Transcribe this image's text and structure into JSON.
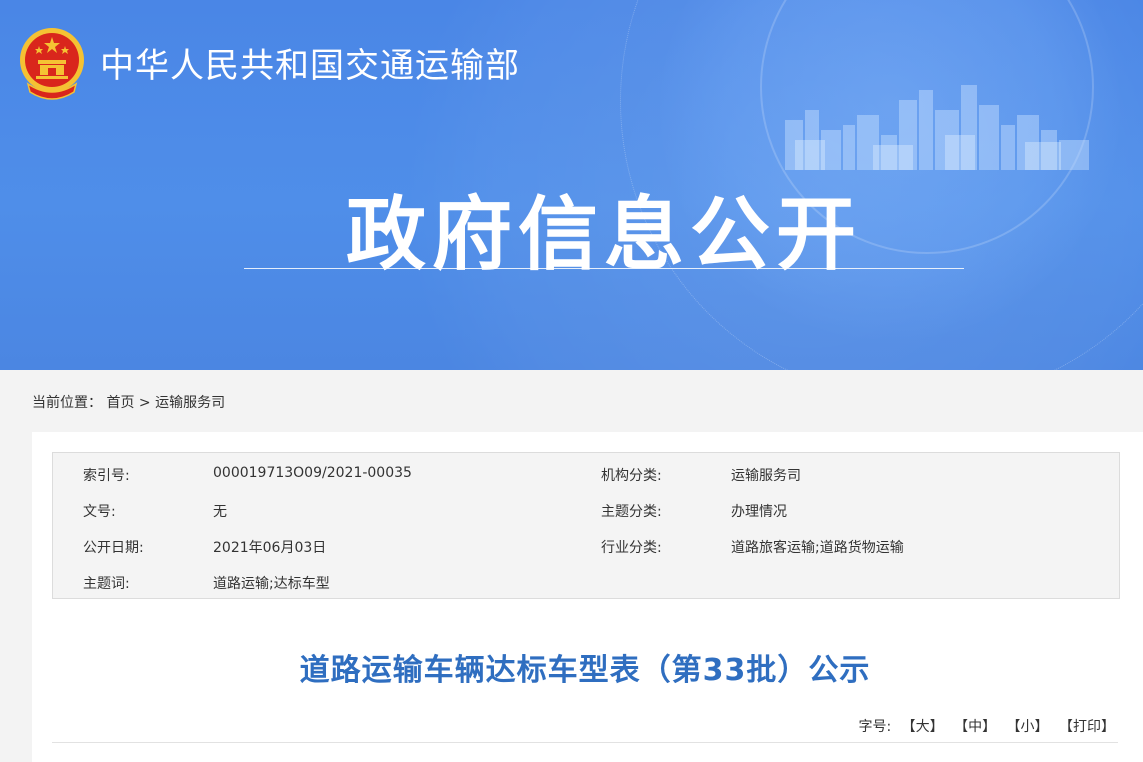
{
  "header": {
    "ministry_title": "中华人民共和国交通运输部",
    "banner_heading": "政府信息公开"
  },
  "breadcrumb": {
    "label": "当前位置：",
    "home": "首页",
    "separator": ">",
    "current": "运输服务司"
  },
  "meta": {
    "index_label": "索引号:",
    "index_value": "000019713O09/2021-00035",
    "org_label": "机构分类:",
    "org_value": "运输服务司",
    "doc_no_label": "文号:",
    "doc_no_value": "无",
    "topic_label": "主题分类:",
    "topic_value": "办理情况",
    "date_label": "公开日期:",
    "date_value": "2021年06月03日",
    "industry_label": "行业分类:",
    "industry_value": "道路旅客运输;道路货物运输",
    "keywords_label": "主题词:",
    "keywords_value": "道路运输;达标车型"
  },
  "article": {
    "title": "道路运输车辆达标车型表（第33批）公示"
  },
  "font_size": {
    "label": "字号:",
    "large": "【大】",
    "medium": "【中】",
    "small": "【小】",
    "print": "【打印】"
  },
  "colors": {
    "banner_blue": "#4a86e6",
    "title_blue": "#2f6ec0",
    "emblem_red": "#d9261c",
    "emblem_gold": "#f5c233"
  }
}
